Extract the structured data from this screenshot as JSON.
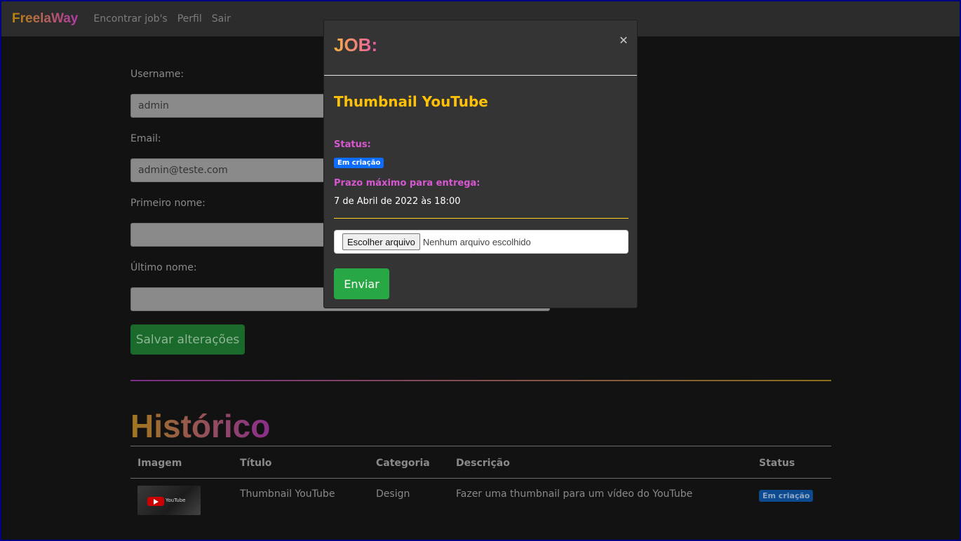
{
  "navbar": {
    "brand": "FreelaWay",
    "links": [
      "Encontrar job's",
      "Perfil",
      "Sair"
    ]
  },
  "profile_form": {
    "fields": [
      {
        "label": "Username:",
        "value": "admin"
      },
      {
        "label": "Email:",
        "value": "admin@teste.com"
      },
      {
        "label": "Primeiro nome:",
        "value": ""
      },
      {
        "label": "Último nome:",
        "value": ""
      }
    ],
    "save_label": "Salvar alterações"
  },
  "history": {
    "title": "Histórico",
    "columns": [
      "Imagem",
      "Título",
      "Categoria",
      "Descrição",
      "Status"
    ],
    "rows": [
      {
        "thumbnail_icon": "youtube-thumbnail",
        "thumbnail_text": "YouTube",
        "title": "Thumbnail YouTube",
        "category": "Design",
        "description": "Fazer uma thumbnail para um vídeo do YouTube",
        "status": "Em criação"
      }
    ]
  },
  "modal": {
    "header": "JOB:",
    "close_icon": "close-icon",
    "job_title": "Thumbnail YouTube",
    "status_label": "Status:",
    "status_badge": "Em criação",
    "deadline_label": "Prazo máximo para entrega:",
    "deadline_value": "7 de Abril de 2022 às 18:00",
    "file_button": "Escolher arquivo",
    "file_placeholder": "Nenhum arquivo escolhido",
    "submit_label": "Enviar"
  },
  "colors": {
    "accent_yellow": "#ffc107",
    "accent_magenta": "#d957d3",
    "success": "#28a745",
    "badge_blue": "#0d6efd"
  }
}
